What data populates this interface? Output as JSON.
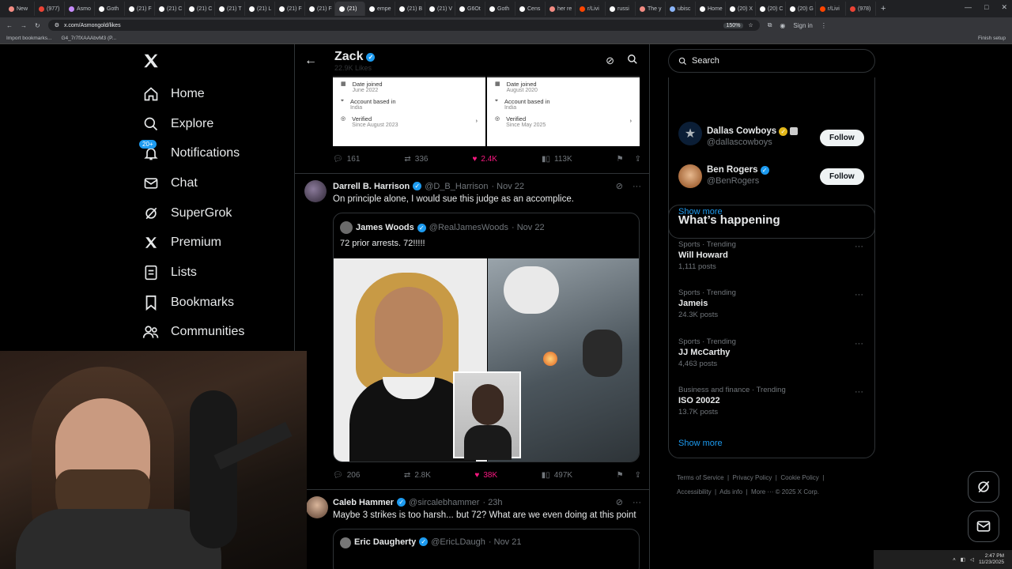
{
  "browser": {
    "tabs": [
      "New",
      "(977)",
      "Asmo",
      "Goth",
      "(21) F",
      "(21) C",
      "(21) C",
      "(21) T",
      "(21) L",
      "(21) F",
      "(21) F",
      "(21)",
      "empe",
      "(21) B",
      "(21) V",
      "G6Ot",
      "Goth",
      "Cens",
      "her re",
      "r/Livi",
      "russi",
      "The y",
      "ubisc",
      "Home",
      "(20) X",
      "(20) C",
      "(20) G",
      "r/Livi",
      "(978)"
    ],
    "active_tab_index": 11,
    "url": "x.com/Asmongold/likes",
    "zoom": "150%",
    "sign_in": "Sign in",
    "finish_setup": "Finish setup",
    "bookmarks": [
      "Import bookmarks...",
      "G4_7r7fXAAAbvM3 (P..."
    ]
  },
  "nav": {
    "items": [
      {
        "label": "Home",
        "icon": "home-icon"
      },
      {
        "label": "Explore",
        "icon": "search-icon"
      },
      {
        "label": "Notifications",
        "icon": "bell-icon"
      },
      {
        "label": "Chat",
        "icon": "mail-icon"
      },
      {
        "label": "SuperGrok",
        "icon": "grok-icon"
      },
      {
        "label": "Premium",
        "icon": "x-logo-icon"
      },
      {
        "label": "Lists",
        "icon": "list-icon"
      },
      {
        "label": "Bookmarks",
        "icon": "bookmark-icon"
      },
      {
        "label": "Communities",
        "icon": "communities-icon"
      }
    ],
    "notification_badge": "20+"
  },
  "profile_header": {
    "name": "Zack",
    "subtitle": "22.9K Likes"
  },
  "info_cards": [
    {
      "date_joined_label": "Date joined",
      "date_joined": "June 2022",
      "account_based_label": "Account based in",
      "account_based": "India",
      "verified_label": "Verified",
      "verified_since": "Since August 2023"
    },
    {
      "date_joined_label": "Date joined",
      "date_joined": "August 2020",
      "account_based_label": "Account based in",
      "account_based": "India",
      "verified_label": "Verified",
      "verified_since": "Since May 2025"
    }
  ],
  "tweet0_actions": {
    "replies": "161",
    "reposts": "336",
    "likes": "2.4K",
    "views": "113K"
  },
  "tweet1": {
    "name": "Darrell B. Harrison",
    "handle": "@D_B_Harrison",
    "date": "· Nov 22",
    "text": "On principle alone, I would sue this judge as an accomplice.",
    "quote": {
      "name": "James Woods",
      "handle": "@RealJamesWoods",
      "date": "· Nov 22",
      "text": "72 prior arrests. 72!!!!!"
    },
    "actions": {
      "replies": "206",
      "reposts": "2.8K",
      "likes": "38K",
      "views": "497K"
    }
  },
  "tweet2": {
    "name": "Caleb Hammer",
    "handle": "@sircalebhammer",
    "date": "· 23h",
    "text": "Maybe 3 strikes is too harsh... but 72? What are we even doing at this point",
    "quote": {
      "name": "Eric Daugherty",
      "handle": "@EricLDaugh",
      "date": "· Nov 21"
    }
  },
  "search": {
    "placeholder": "Search"
  },
  "who_to_follow": {
    "accounts": [
      {
        "name": "Dallas Cowboys",
        "handle": "@dallascowboys",
        "button": "Follow"
      },
      {
        "name": "Ben Rogers",
        "handle": "@BenRogers",
        "button": "Follow"
      }
    ],
    "show_more": "Show more"
  },
  "whats_happening": {
    "title": "What’s happening",
    "trends": [
      {
        "category": "Sports · Trending",
        "title": "Will Howard",
        "count": "1,111 posts"
      },
      {
        "category": "Sports · Trending",
        "title": "Jameis",
        "count": "24.3K posts"
      },
      {
        "category": "Sports · Trending",
        "title": "JJ McCarthy",
        "count": "4,463 posts"
      },
      {
        "category": "Business and finance · Trending",
        "title": "ISO 20022",
        "count": "13.7K posts"
      }
    ],
    "show_more": "Show more"
  },
  "footer": {
    "links": [
      "Terms of Service",
      "Privacy Policy",
      "Cookie Policy",
      "Accessibility",
      "Ads info",
      "More ···"
    ],
    "copyright": "© 2025 X Corp."
  },
  "taskbar": {
    "time": "2:47 PM",
    "date": "11/23/2025"
  },
  "colors": {
    "accent": "#1d9bf0",
    "like": "#f91880",
    "gold_badge": "#e2b719"
  }
}
